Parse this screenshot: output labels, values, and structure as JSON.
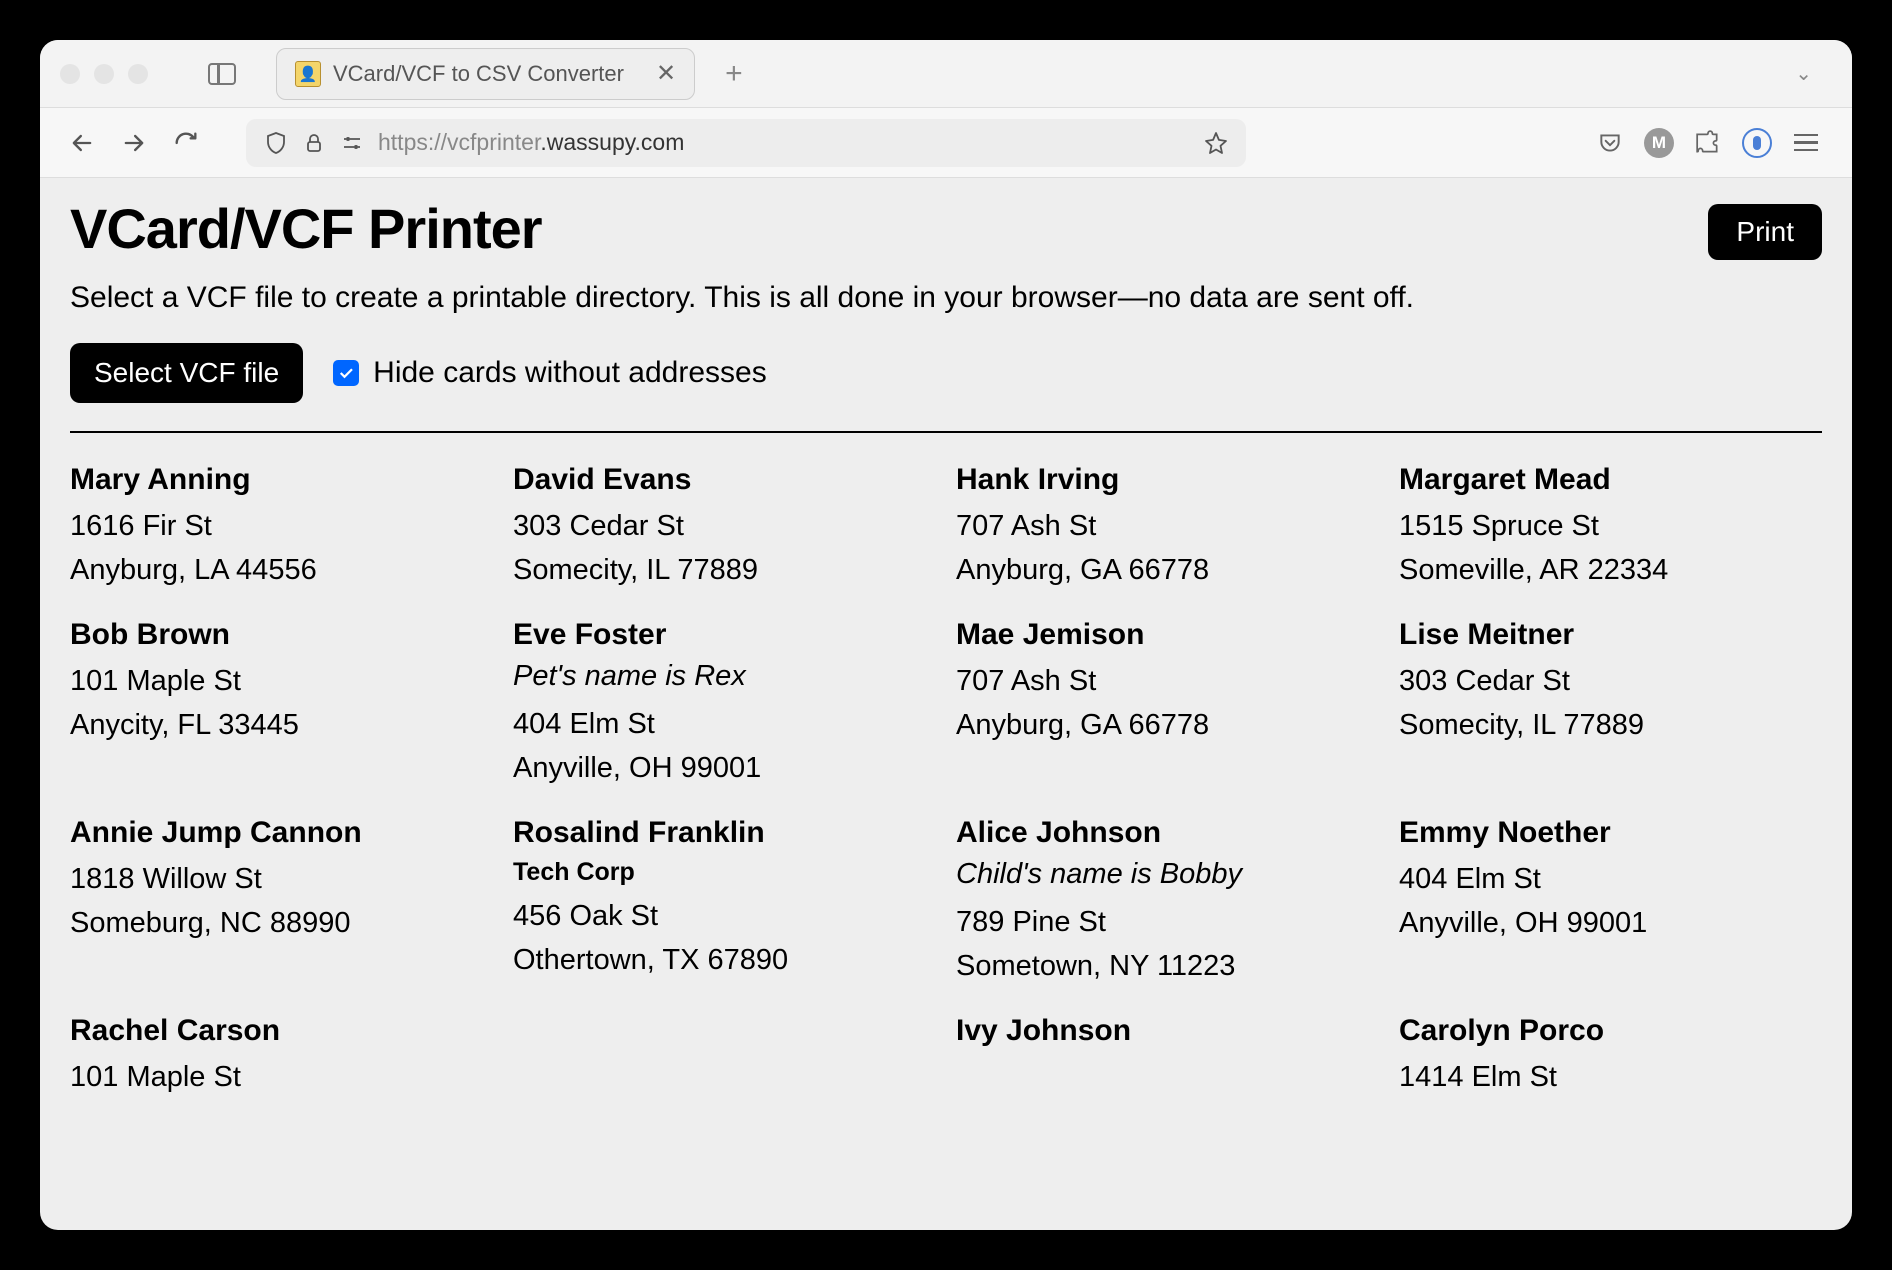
{
  "browser": {
    "tab_title": "VCard/VCF to CSV Converter",
    "url_prefix": "https://vcfprinter",
    "url_domain": ".wassupy.com",
    "account_initial": "M"
  },
  "page": {
    "title": "VCard/VCF Printer",
    "print_label": "Print",
    "description": "Select a VCF file to create a printable directory. This is all done in your browser—no data are sent off.",
    "select_label": "Select VCF file",
    "checkbox_label": "Hide cards without addresses"
  },
  "cards": [
    {
      "name": "Mary Anning",
      "line1": "1616 Fir St",
      "line2": "Anyburg, LA 44556"
    },
    {
      "name": "Bob Brown",
      "line1": "101 Maple St",
      "line2": "Anycity, FL 33445"
    },
    {
      "name": "Annie Jump Cannon",
      "line1": "1818 Willow St",
      "line2": "Someburg, NC 88990"
    },
    {
      "name": "Rachel Carson",
      "line1": "101 Maple St",
      "line2": ""
    },
    {
      "name": "David Evans",
      "line1": "303 Cedar St",
      "line2": "Somecity, IL 77889"
    },
    {
      "name": "Eve Foster",
      "note": "Pet's name is Rex",
      "line1": "404 Elm St",
      "line2": "Anyville, OH 99001"
    },
    {
      "name": "Rosalind Franklin",
      "company": "Tech Corp",
      "line1": "456 Oak St",
      "line2": "Othertown, TX 67890"
    },
    null,
    {
      "name": "Hank Irving",
      "line1": "707 Ash St",
      "line2": "Anyburg, GA 66778"
    },
    {
      "name": "Mae Jemison",
      "line1": "707 Ash St",
      "line2": "Anyburg, GA 66778"
    },
    {
      "name": "Alice Johnson",
      "note": "Child's name is Bobby",
      "line1": "789 Pine St",
      "line2": "Sometown, NY 11223"
    },
    {
      "name": "Ivy Johnson",
      "line1": "",
      "line2": ""
    },
    {
      "name": "Margaret Mead",
      "line1": "1515 Spruce St",
      "line2": "Someville, AR 22334"
    },
    {
      "name": "Lise Meitner",
      "line1": "303 Cedar St",
      "line2": "Somecity, IL 77889"
    },
    {
      "name": "Emmy Noether",
      "line1": "404 Elm St",
      "line2": "Anyville, OH 99001"
    },
    {
      "name": "Carolyn Porco",
      "line1": "1414 Elm St",
      "line2": ""
    }
  ]
}
